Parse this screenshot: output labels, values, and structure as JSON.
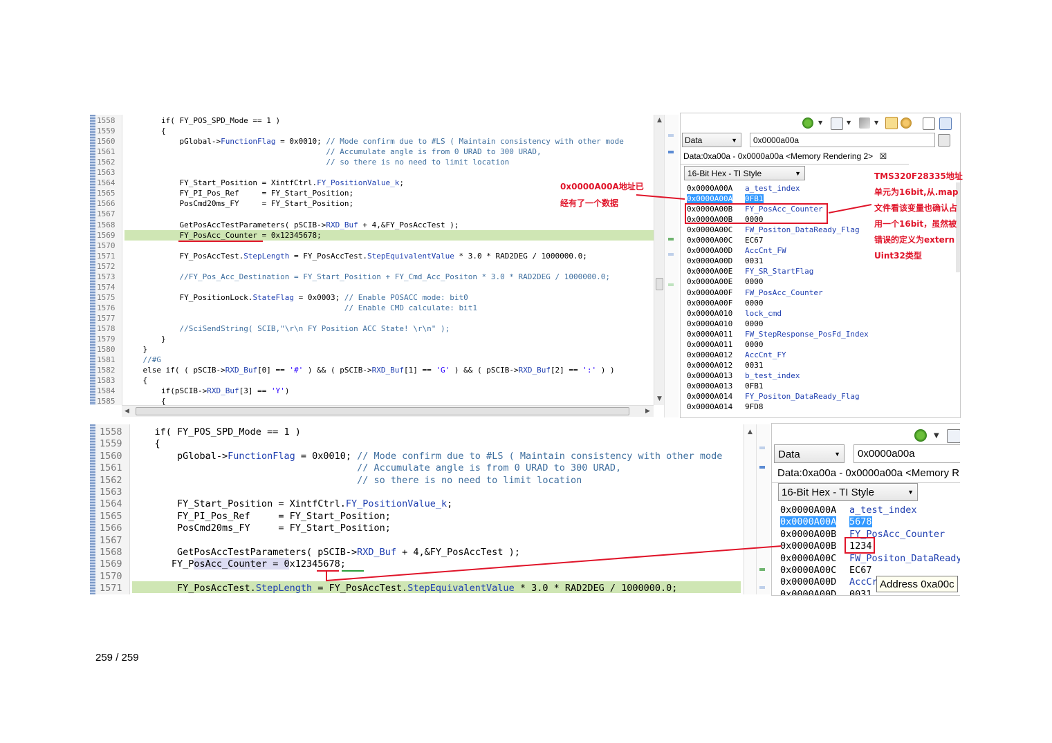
{
  "top": {
    "line_numbers": [
      "1558",
      "1559",
      "1560",
      "1561",
      "1562",
      "1563",
      "1564",
      "1565",
      "1566",
      "1567",
      "1568",
      "1569",
      "1570",
      "1571",
      "1572",
      "1573",
      "1574",
      "1575",
      "1576",
      "1577",
      "1578",
      "1579",
      "1580",
      "1581",
      "1582",
      "1583",
      "1584",
      "1585"
    ],
    "code_lines": [
      "        if( FY_POS_SPD_Mode == 1 )",
      "        {",
      "            pGlobal->FunctionFlag = 0x0010; // Mode confirm due to #LS ( Maintain consistency with other mode",
      "                                            // Accumulate angle is from 0 URAD to 300 URAD,",
      "                                            // so there is no need to limit location",
      "",
      "            FY_Start_Position = XintfCtrl.FY_PositionValue_k;",
      "            FY_PI_Pos_Ref     = FY_Start_Position;",
      "            PosCmd20ms_FY     = FY_Start_Position;",
      "",
      "            GetPosAccTestParameters( pSCIB->RXD_Buf + 4,&FY_PosAccTest );",
      "            FY_PosAcc_Counter = 0x12345678;",
      "",
      "            FY_PosAccTest.StepLength = FY_PosAccTest.StepEquivalentValue * 3.0 * RAD2DEG / 1000000.0;",
      "",
      "            //FY_Pos_Acc_Destination = FY_Start_Position + FY_Cmd_Acc_Positon * 3.0 * RAD2DEG / 1000000.0;",
      "",
      "            FY_PositionLock.StateFlag = 0x0003; // Enable POSACC mode: bit0",
      "                                                // Enable CMD calculate: bit1",
      "",
      "            //SciSendString( SCIB,\"\\r\\n FY Position ACC State! \\r\\n\" );",
      "        }",
      "    }",
      "    //#G",
      "    else if( ( pSCIB->RXD_Buf[0] == '#' ) && ( pSCIB->RXD_Buf[1] == 'G' ) && ( pSCIB->RXD_Buf[2] == ':' ) )",
      "    {",
      "        if(pSCIB->RXD_Buf[3] == 'Y')",
      "        {"
    ],
    "memory": {
      "format_combo": "Data",
      "address_field": "0x0000a00a",
      "tab_title": "Data:0xa00a - 0x0000a00a <Memory Rendering 2>",
      "style_combo": "16-Bit Hex - TI Style",
      "rows": [
        {
          "addr": "0x0000A00A",
          "val": "a_test_index",
          "kind": "sym"
        },
        {
          "addr": "0x0000A00A",
          "val": "0FB1",
          "kind": "sel"
        },
        {
          "addr": "0x0000A00B",
          "val": "FY_PosAcc_Counter",
          "kind": "sym"
        },
        {
          "addr": "0x0000A00B",
          "val": "0000",
          "kind": "hex"
        },
        {
          "addr": "0x0000A00C",
          "val": "FW_Positon_DataReady_Flag",
          "kind": "sym"
        },
        {
          "addr": "0x0000A00C",
          "val": "EC67",
          "kind": "hex"
        },
        {
          "addr": "0x0000A00D",
          "val": "AccCnt_FW",
          "kind": "sym"
        },
        {
          "addr": "0x0000A00D",
          "val": "0031",
          "kind": "hex"
        },
        {
          "addr": "0x0000A00E",
          "val": "FY_SR_StartFlag",
          "kind": "sym"
        },
        {
          "addr": "0x0000A00E",
          "val": "0000",
          "kind": "hex"
        },
        {
          "addr": "0x0000A00F",
          "val": "FW_PosAcc_Counter",
          "kind": "sym"
        },
        {
          "addr": "0x0000A00F",
          "val": "0000",
          "kind": "hex"
        },
        {
          "addr": "0x0000A010",
          "val": "lock_cmd",
          "kind": "sym"
        },
        {
          "addr": "0x0000A010",
          "val": "0000",
          "kind": "hex"
        },
        {
          "addr": "0x0000A011",
          "val": "FW_StepResponse_PosFd_Index",
          "kind": "sym"
        },
        {
          "addr": "0x0000A011",
          "val": "0000",
          "kind": "hex"
        },
        {
          "addr": "0x0000A012",
          "val": "AccCnt_FY",
          "kind": "sym"
        },
        {
          "addr": "0x0000A012",
          "val": "0031",
          "kind": "hex"
        },
        {
          "addr": "0x0000A013",
          "val": "b_test_index",
          "kind": "sym"
        },
        {
          "addr": "0x0000A013",
          "val": "0FB1",
          "kind": "hex"
        },
        {
          "addr": "0x0000A014",
          "val": "FY_Positon_DataReady_Flag",
          "kind": "sym"
        },
        {
          "addr": "0x0000A014",
          "val": "9FD8",
          "kind": "hex"
        }
      ]
    }
  },
  "bottom": {
    "line_numbers": [
      "1558",
      "1559",
      "1560",
      "1561",
      "1562",
      "1563",
      "1564",
      "1565",
      "1566",
      "1567",
      "1568",
      "1569",
      "1570",
      "1571"
    ],
    "code_lines": [
      "    if( FY_POS_SPD_Mode == 1 )",
      "    {",
      "        pGlobal->FunctionFlag = 0x0010; // Mode confirm due to #LS ( Maintain consistency with other mode",
      "                                        // Accumulate angle is from 0 URAD to 300 URAD,",
      "                                        // so there is no need to limit location",
      "",
      "        FY_Start_Position = XintfCtrl.FY_PositionValue_k;",
      "        FY_PI_Pos_Ref     = FY_Start_Position;",
      "        PosCmd20ms_FY     = FY_Start_Position;",
      "",
      "        GetPosAccTestParameters( pSCIB->RXD_Buf + 4,&FY_PosAccTest );",
      "       FY_PosAcc_Counter = 0x12345678;",
      "",
      "        FY_PosAccTest.StepLength = FY_PosAccTest.StepEquivalentValue * 3.0 * RAD2DEG / 1000000.0;"
    ],
    "memory": {
      "format_combo": "Data",
      "address_field": "0x0000a00a",
      "tab_title": "Data:0xa00a - 0x0000a00a <Memory R",
      "style_combo": "16-Bit Hex - TI Style",
      "rows": [
        {
          "addr": "0x0000A00A",
          "val": "a_test_index",
          "kind": "sym"
        },
        {
          "addr": "0x0000A00A",
          "val": "5678",
          "kind": "sel"
        },
        {
          "addr": "0x0000A00B",
          "val": "FY_PosAcc_Counter",
          "kind": "sym"
        },
        {
          "addr": "0x0000A00B",
          "val": "1234",
          "kind": "hex"
        },
        {
          "addr": "0x0000A00C",
          "val": "FW_Positon_DataReady",
          "kind": "sym"
        },
        {
          "addr": "0x0000A00C",
          "val": "EC67",
          "kind": "hex"
        },
        {
          "addr": "0x0000A00D",
          "val": "AccCr",
          "kind": "sym"
        },
        {
          "addr": "0x0000A00D",
          "val": "0031",
          "kind": "hex"
        }
      ],
      "tooltip": "Address 0xa00c"
    }
  },
  "annotations": {
    "left_line1": "0x0000A00A地址已",
    "left_line2": "经有了一个数据",
    "right_lines": [
      "TMS320F28335地址",
      "单元为16bit,从.map",
      "文件看该变量也确认占",
      "用一个16bit，虽然被",
      "错误的定义为extern",
      "Uint32类型"
    ]
  },
  "footer": {
    "page": "259 / 259"
  },
  "colors": {
    "annotation_red": "#e0152a",
    "symbol_blue": "#1f3fb0",
    "selection": "#3399ff",
    "highlight_green": "#cfe6b4"
  }
}
